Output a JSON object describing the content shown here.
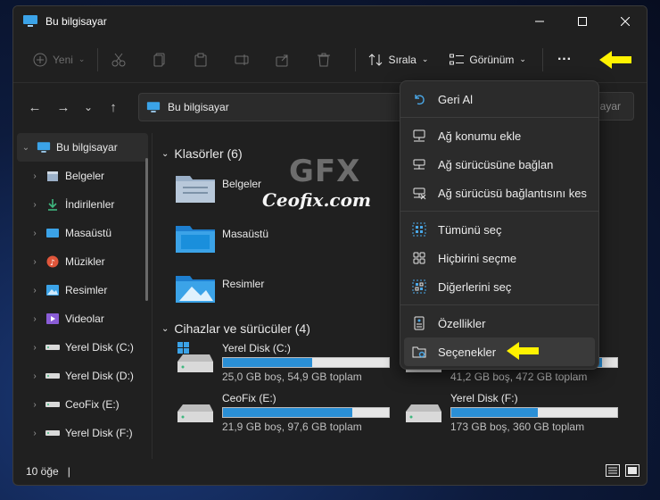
{
  "window": {
    "title": "Bu bilgisayar"
  },
  "toolbar": {
    "new_label": "Yeni",
    "sort_label": "Sırala",
    "view_label": "Görünüm",
    "more_label": "···"
  },
  "address": {
    "path": "Bu bilgisayar",
    "search_placeholder": "ayar"
  },
  "sidebar": {
    "items": [
      {
        "label": "Bu bilgisayar"
      },
      {
        "label": "Belgeler"
      },
      {
        "label": "İndirilenler"
      },
      {
        "label": "Masaüstü"
      },
      {
        "label": "Müzikler"
      },
      {
        "label": "Resimler"
      },
      {
        "label": "Videolar"
      },
      {
        "label": "Yerel Disk (C:)"
      },
      {
        "label": "Yerel Disk (D:)"
      },
      {
        "label": "CeoFix (E:)"
      },
      {
        "label": "Yerel Disk (F:)"
      }
    ]
  },
  "content": {
    "folders_header": "Klasörler (6)",
    "folders": [
      {
        "label": "Belgeler"
      },
      {
        "label": "Masaüstü"
      },
      {
        "label": "Resimler"
      }
    ],
    "drives_header": "Cihazlar ve sürücüler (4)",
    "drives": [
      {
        "label": "Yerel Disk (C:)",
        "usage": "25,0 GB boş, 54,9 GB toplam",
        "used_fraction": 0.54
      },
      {
        "label": "",
        "usage": "41,2 GB boş, 472 GB toplam",
        "used_fraction": 0.91
      },
      {
        "label": "CeoFix (E:)",
        "usage": "21,9 GB boş, 97,6 GB toplam",
        "used_fraction": 0.78
      },
      {
        "label": "Yerel Disk (F:)",
        "usage": "173 GB boş, 360 GB toplam",
        "used_fraction": 0.52
      }
    ]
  },
  "menu": {
    "items": [
      {
        "label": "Geri Al",
        "icon": "undo-icon"
      },
      {
        "label": "Ağ konumu ekle",
        "icon": "network-location-icon"
      },
      {
        "label": "Ağ sürücüsüne bağlan",
        "icon": "map-drive-icon"
      },
      {
        "label": "Ağ sürücüsü bağlantısını kes",
        "icon": "disconnect-drive-icon"
      },
      {
        "label": "Tümünü seç",
        "icon": "select-all-icon"
      },
      {
        "label": "Hiçbirini seçme",
        "icon": "select-none-icon"
      },
      {
        "label": "Diğerlerini seç",
        "icon": "invert-selection-icon"
      },
      {
        "label": "Özellikler",
        "icon": "properties-icon"
      },
      {
        "label": "Seçenekler",
        "icon": "options-icon"
      }
    ]
  },
  "status": {
    "count": "10 öğe"
  },
  "watermark": {
    "top": "GFX",
    "bottom": "Ceofix.com"
  },
  "colors": {
    "accent": "#2a8fd6",
    "arrow": "#fff200"
  }
}
